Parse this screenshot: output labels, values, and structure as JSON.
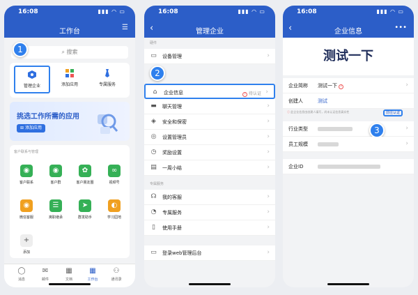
{
  "status": {
    "time": "16:08",
    "icons": "▮▮▮ ◠ ▭"
  },
  "phone1": {
    "title": "工作台",
    "filter_icon": "filter-icon",
    "search_placeholder": "搜索",
    "quick": [
      {
        "label": "管理企业",
        "icon": "hexagon-icon",
        "color": "#2f6fe0"
      },
      {
        "label": "添加应用",
        "icon": "grid-icon",
        "color": "#f0a020"
      },
      {
        "label": "专属服务",
        "icon": "tie-icon",
        "color": "#2f6fe0"
      }
    ],
    "banner": {
      "title": "挑选工作所需的应用",
      "button": "添加应用"
    },
    "section_title": "客户联系与管理",
    "apps": [
      {
        "label": "客户联系",
        "color": "#35b056",
        "glyph": "◉"
      },
      {
        "label": "客户群",
        "color": "#35b056",
        "glyph": "◉"
      },
      {
        "label": "客户朋友圈",
        "color": "#35b056",
        "glyph": "✿"
      },
      {
        "label": "视频号",
        "color": "#35b056",
        "glyph": "∞"
      },
      {
        "label": "微信客服",
        "color": "#f0a020",
        "glyph": "◉"
      },
      {
        "label": "离职继承",
        "color": "#35b056",
        "glyph": "☰"
      },
      {
        "label": "群发助手",
        "color": "#35b056",
        "glyph": "➤"
      },
      {
        "label": "学习园地",
        "color": "#f0a020",
        "glyph": "◐"
      },
      {
        "label": "添加",
        "color": "#e8e8e8",
        "glyph": "+"
      }
    ],
    "tabs": [
      {
        "label": "消息",
        "icon": "chat-icon",
        "glyph": "◯"
      },
      {
        "label": "邮件",
        "icon": "mail-icon",
        "glyph": "✉"
      },
      {
        "label": "文档",
        "icon": "doc-icon",
        "glyph": "▦"
      },
      {
        "label": "工作台",
        "icon": "workbench-icon",
        "glyph": "▦"
      },
      {
        "label": "通讯录",
        "icon": "contacts-icon",
        "glyph": "⚇"
      }
    ],
    "step": "1"
  },
  "phone2": {
    "title": "管理企业",
    "group1": "硬件",
    "group2": "专属服务",
    "rows": [
      {
        "label": "设备管理",
        "icon": "device-icon",
        "glyph": "▭"
      },
      {
        "label": "企业信息",
        "icon": "home-icon",
        "glyph": "⌂",
        "status": "待认证"
      },
      {
        "label": "聊天管理",
        "icon": "chat-icon",
        "glyph": "▬"
      },
      {
        "label": "安全和保密",
        "icon": "shield-icon",
        "glyph": "◈"
      },
      {
        "label": "设置管理员",
        "icon": "admin-icon",
        "glyph": "◎"
      },
      {
        "label": "奖励设置",
        "icon": "reward-icon",
        "glyph": "◷"
      },
      {
        "label": "一周小结",
        "icon": "report-icon",
        "glyph": "▤"
      },
      {
        "label": "我的客服",
        "icon": "headset-icon",
        "glyph": "☊"
      },
      {
        "label": "专属服务",
        "icon": "service-icon",
        "glyph": "◔"
      },
      {
        "label": "使用手册",
        "icon": "manual-icon",
        "glyph": "▯"
      },
      {
        "label": "登录web管理后台",
        "icon": "web-icon",
        "glyph": "▭"
      }
    ],
    "step": "2"
  },
  "phone3": {
    "title": "企业信息",
    "company_display": "测试一下",
    "rows": [
      {
        "label": "企业简称",
        "value": "测试一下"
      },
      {
        "label": "创建人",
        "value": "测试"
      },
      {
        "label": "行业类型",
        "value": ""
      },
      {
        "label": "员工规模",
        "value": ""
      },
      {
        "label": "企业ID",
        "value": ""
      }
    ],
    "warning": "此企业信息由创建人填写，尚未认证信息真实性",
    "verify_button": "前往认证",
    "step": "3"
  }
}
